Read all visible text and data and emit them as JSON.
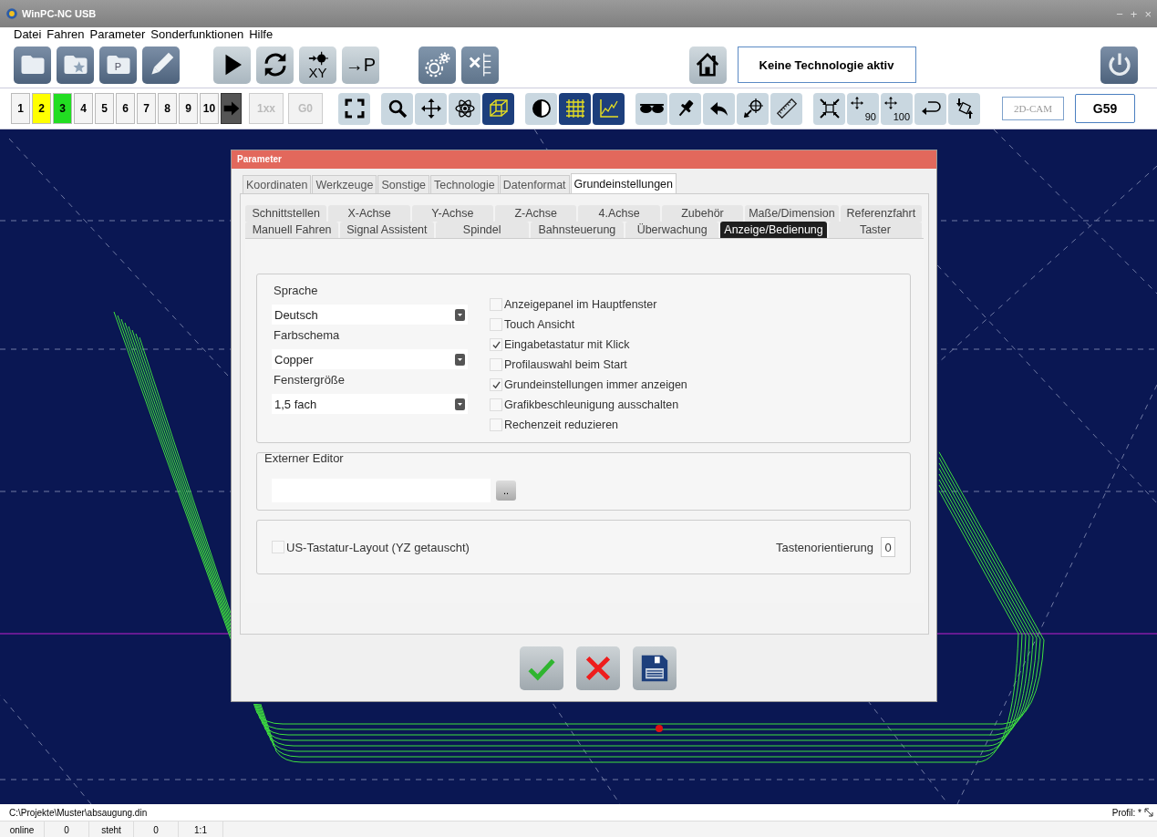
{
  "window": {
    "title": "WinPC-NC USB",
    "controls": [
      "−",
      "+",
      "×"
    ]
  },
  "menu": [
    "Datei",
    "Fahren",
    "Parameter",
    "Sonderfunktionen",
    "Hilfe"
  ],
  "main_toolbar": {
    "folder_letter": "P",
    "xy_label": "XY",
    "park_label": "→P",
    "technology": "Keine Technologie aktiv"
  },
  "number_buttons": [
    {
      "label": "1",
      "color": "#f4f4f4"
    },
    {
      "label": "2",
      "color": "#ffff00"
    },
    {
      "label": "3",
      "color": "#22dd22"
    },
    {
      "label": "4",
      "color": "#f4f4f4"
    },
    {
      "label": "5",
      "color": "#f4f4f4"
    },
    {
      "label": "6",
      "color": "#f4f4f4"
    },
    {
      "label": "7",
      "color": "#f4f4f4"
    },
    {
      "label": "8",
      "color": "#f4f4f4"
    },
    {
      "label": "9",
      "color": "#f4f4f4"
    },
    {
      "label": "10",
      "color": "#f4f4f4"
    }
  ],
  "mode_buttons": [
    {
      "label": "1xx",
      "disabled": true
    },
    {
      "label": "G0",
      "disabled": true
    }
  ],
  "view_toolbar": [
    [
      {
        "on": false
      }
    ],
    [
      {
        "on": false
      },
      {
        "on": false
      },
      {
        "on": false
      },
      {
        "on": true
      }
    ],
    [
      {
        "on": false
      },
      {
        "on": true
      },
      {
        "on": true
      }
    ],
    [
      {
        "on": false
      },
      {
        "on": false
      },
      {
        "on": false
      },
      {
        "on": false
      },
      {
        "on": false
      }
    ],
    [
      {
        "on": false
      },
      {
        "on": false,
        "label": "90"
      },
      {
        "on": false,
        "label": "100"
      },
      {
        "on": false
      },
      {
        "on": false
      }
    ]
  ],
  "cam_button": {
    "label": "2D-CAM",
    "disabled": true
  },
  "offset_button": {
    "label": "G59"
  },
  "dialog": {
    "title": "Parameter",
    "tabs": [
      {
        "label": "Koordinaten",
        "selected": false
      },
      {
        "label": "Werkzeuge",
        "selected": false
      },
      {
        "label": "Sonstige",
        "selected": false
      },
      {
        "label": "Technologie",
        "selected": false
      },
      {
        "label": "Datenformat",
        "selected": false
      },
      {
        "label": "Grundeinstellungen",
        "selected": true
      }
    ],
    "subtabs_row_1": [
      {
        "label": "Schnittstellen",
        "selected": false
      },
      {
        "label": "X-Achse",
        "selected": false
      },
      {
        "label": "Y-Achse",
        "selected": false
      },
      {
        "label": "Z-Achse",
        "selected": false
      },
      {
        "label": "4.Achse",
        "selected": false
      },
      {
        "label": "Zubehör",
        "selected": false
      },
      {
        "label": "Maße/Dimension",
        "selected": false
      },
      {
        "label": "Referenzfahrt",
        "selected": false
      }
    ],
    "subtabs_row_2": [
      {
        "label": "Manuell Fahren",
        "selected": false
      },
      {
        "label": "Signal Assistent",
        "selected": false
      },
      {
        "label": "Spindel",
        "selected": false
      },
      {
        "label": "Bahnsteuerung",
        "selected": false
      },
      {
        "label": "Überwachung",
        "selected": false
      },
      {
        "label": "Anzeige/Bedienung",
        "selected": true
      },
      {
        "label": "Taster",
        "selected": false
      }
    ],
    "dropdowns": [
      {
        "label": "Sprache",
        "value": "Deutsch"
      },
      {
        "label": "Farbschema",
        "value": "Copper"
      },
      {
        "label": "Fenstergröße",
        "value": "1,5 fach"
      }
    ],
    "options": [
      {
        "label": "Anzeigepanel im Hauptfenster",
        "checked": false
      },
      {
        "label": "Touch Ansicht",
        "checked": false
      },
      {
        "label": "Eingabetastatur mit Klick",
        "checked": true
      },
      {
        "label": "Profilauswahl beim Start",
        "checked": false
      },
      {
        "label": "Grundeinstellungen immer anzeigen",
        "checked": true
      },
      {
        "label": "Grafikbeschleunigung ausschalten",
        "checked": false
      },
      {
        "label": "Rechenzeit reduzieren",
        "checked": false
      }
    ],
    "editor": {
      "title": "Externer Editor",
      "browse": ".."
    },
    "keyboard": {
      "label": "US-Tastatur-Layout (YZ getauscht)",
      "checked": false,
      "orientation_label": "Tastenorientierung",
      "orientation_value": "0"
    }
  },
  "status_bar": {
    "path": "C:\\Projekte\\Muster\\absaugung.din",
    "profile": "Profil: *",
    "cells": [
      "online",
      "0",
      "steht",
      "0",
      "1:1"
    ]
  }
}
